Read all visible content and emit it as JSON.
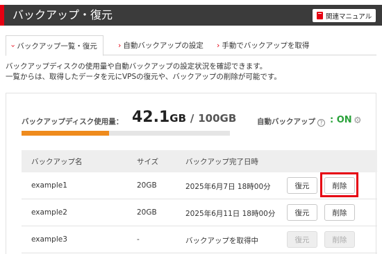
{
  "header": {
    "title": "バックアップ・復元",
    "manual_button": "関連マニュアル"
  },
  "tabs": [
    {
      "label": "バックアップ一覧・復元",
      "active": true
    },
    {
      "label": "自動バックアップの設定",
      "active": false
    },
    {
      "label": "手動でバックアップを取得",
      "active": false
    }
  ],
  "description": [
    "バックアップディスクの使用量や自動バックアップの設定状況を確認できます。",
    "一覧からは、取得したデータを元にVPSの復元や、バックアップの削除が可能です。"
  ],
  "usage": {
    "label": "バックアップディスク使用量：",
    "used": "42.1",
    "used_unit": "GB",
    "slash": "/",
    "total": "100GB",
    "fraction": 0.421,
    "bar_color": "#ef8b1d"
  },
  "auto_backup": {
    "label": "自動バックアップ",
    "status": ": ON",
    "status_color": "#2aa23a"
  },
  "table": {
    "headers": [
      "バックアップ名",
      "サイズ",
      "バックアップ完了日時"
    ],
    "rows": [
      {
        "name": "example1",
        "size": "20GB",
        "completed": "2025年6月7日 18時00分",
        "restore": "復元",
        "delete": "削除",
        "enabled": true
      },
      {
        "name": "example2",
        "size": "20GB",
        "completed": "2025年6月11日 18時00分",
        "restore": "復元",
        "delete": "削除",
        "enabled": true
      },
      {
        "name": "example3",
        "size": "-",
        "completed": "バックアップを取得中",
        "restore": "復元",
        "delete": "削除",
        "enabled": false
      }
    ]
  },
  "colors": {
    "accent": "#e60012",
    "header_bg": "#3b3b3b"
  }
}
